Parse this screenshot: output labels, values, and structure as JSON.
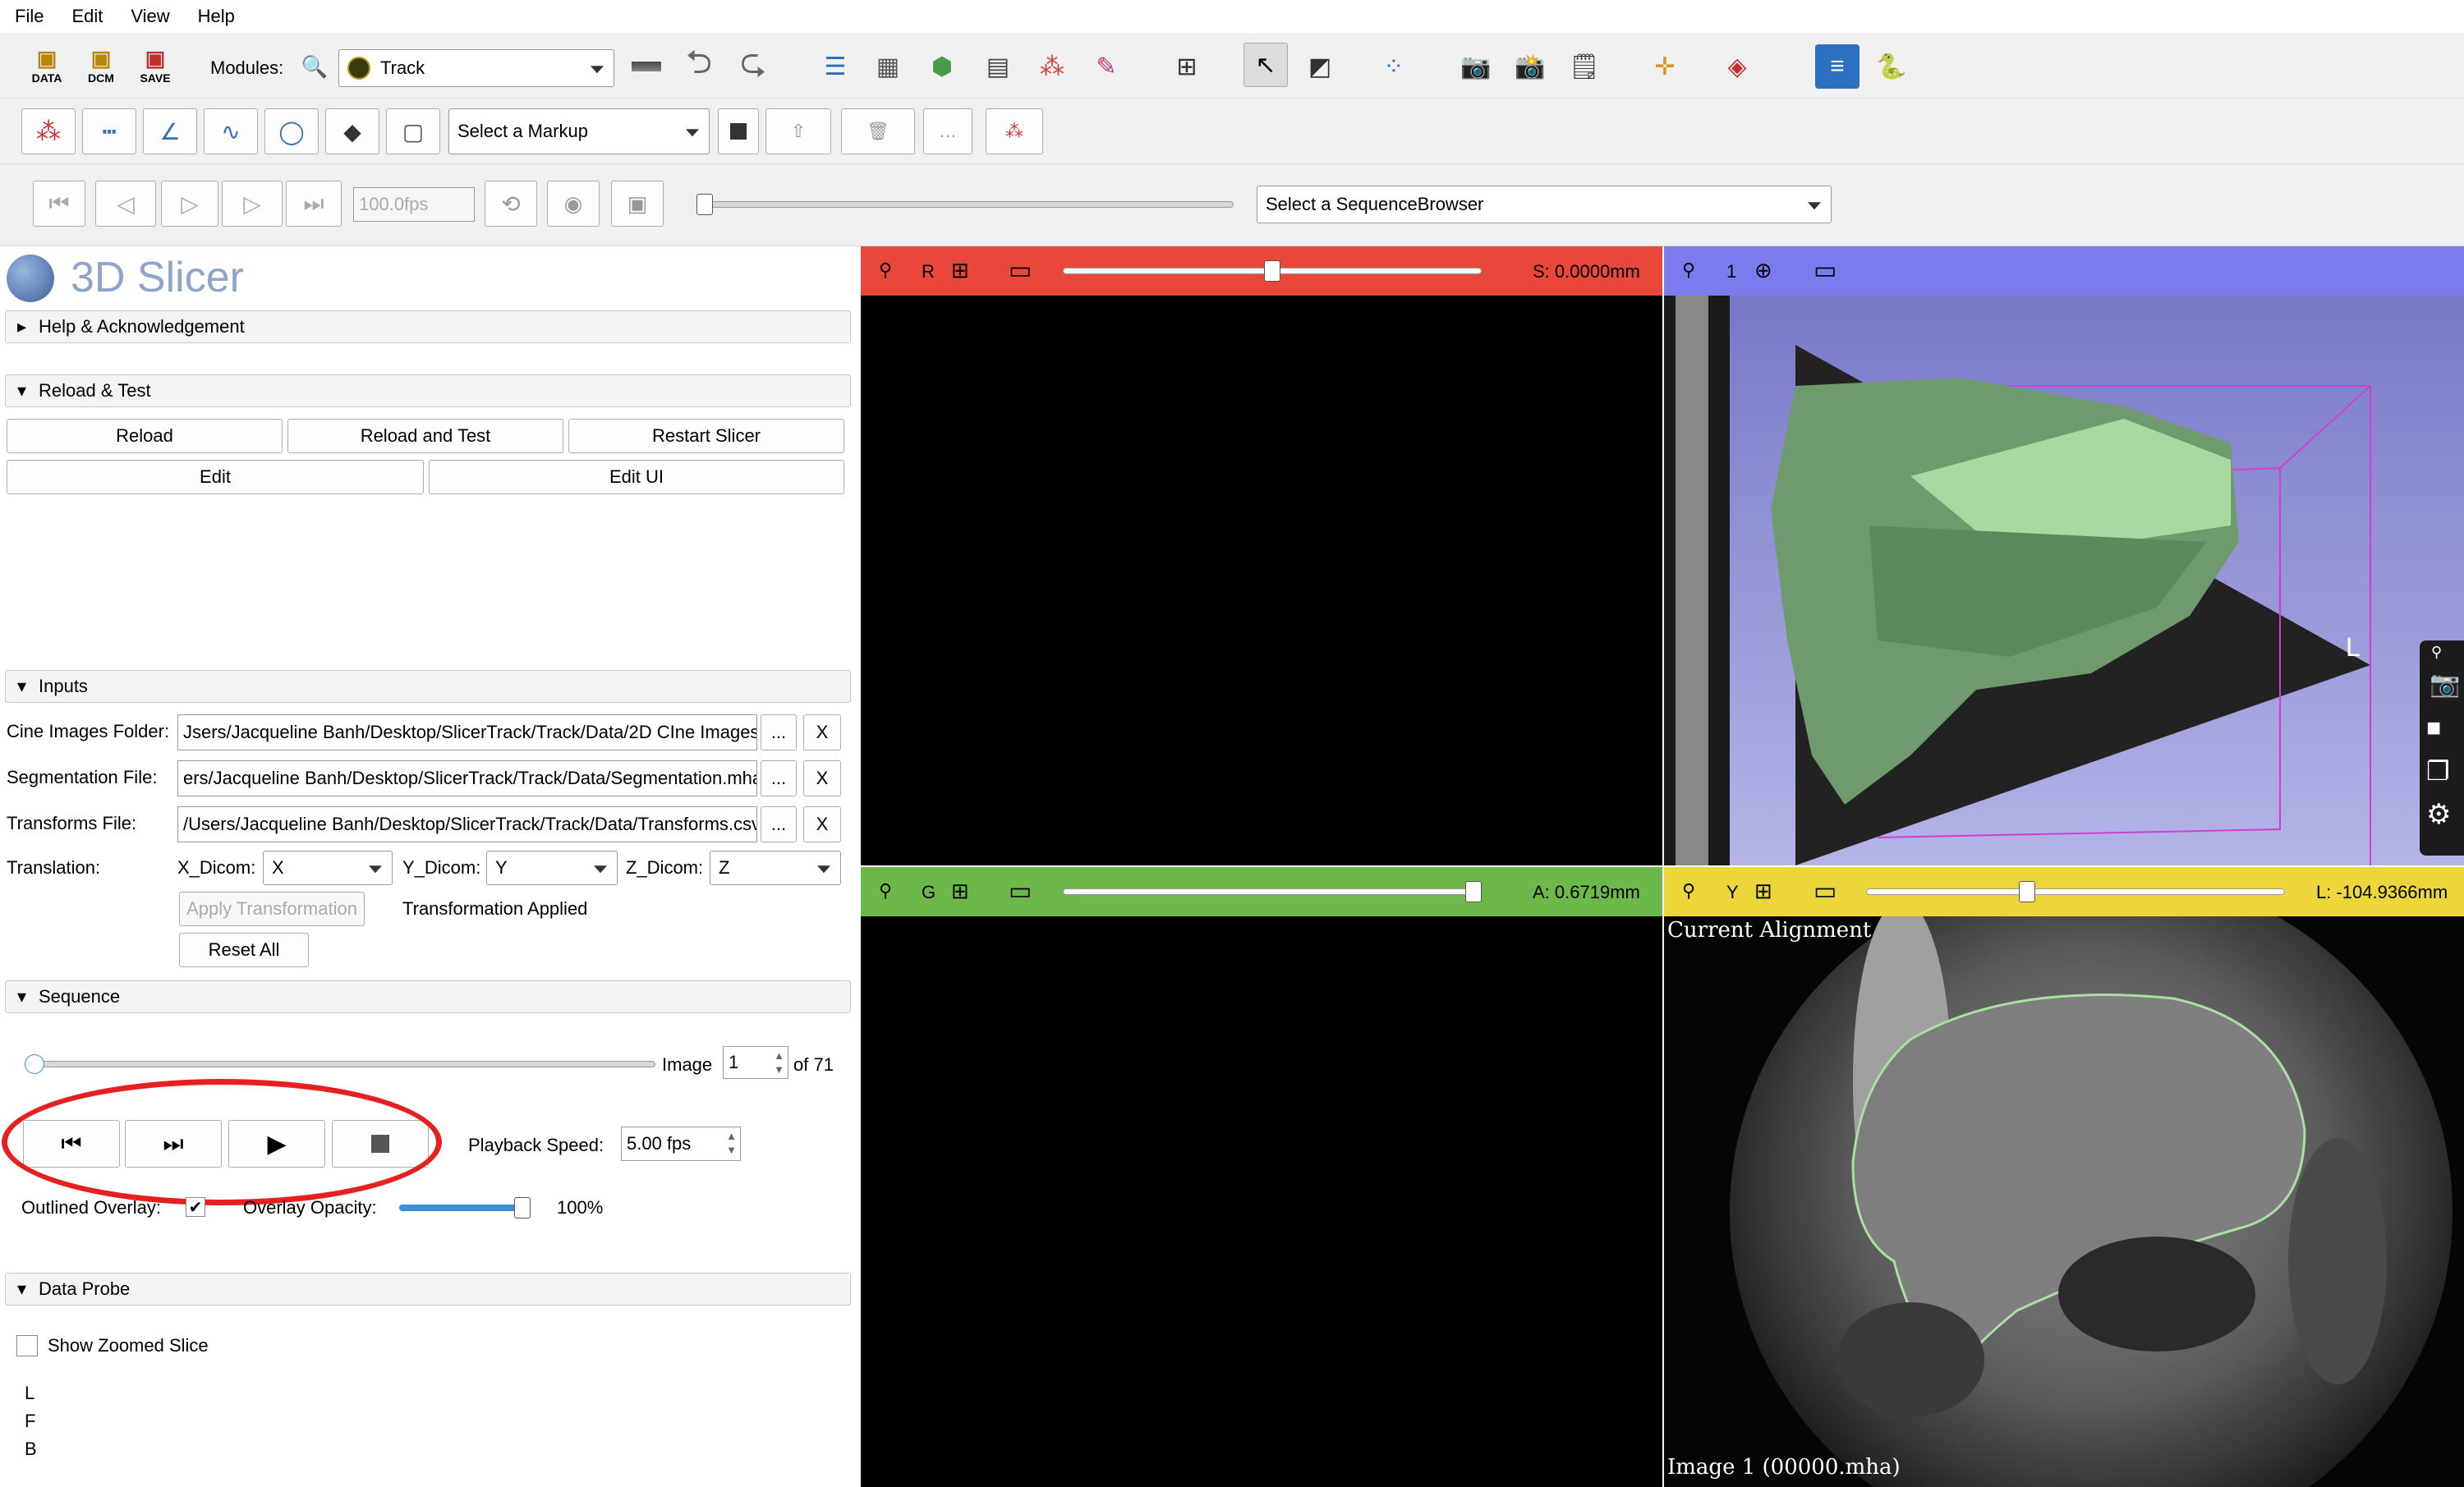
{
  "menu": [
    "File",
    "Edit",
    "View",
    "Help"
  ],
  "toolbar": {
    "data_label": "DATA",
    "dcm_label": "DCM",
    "save_label": "SAVE",
    "modules_label": "Modules:",
    "module_selected": "Track",
    "markup_placeholder": "Select a Markup",
    "fps_value": "100.0fps",
    "sequence_browser_placeholder": "Select a SequenceBrowser"
  },
  "app": {
    "title": "3D Slicer"
  },
  "sections": {
    "help": "Help & Acknowledgement",
    "reload": "Reload & Test",
    "inputs": "Inputs",
    "sequence": "Sequence",
    "data_probe": "Data Probe"
  },
  "reload_buttons": {
    "reload": "Reload",
    "reload_test": "Reload and Test",
    "restart": "Restart Slicer",
    "edit": "Edit",
    "edit_ui": "Edit UI"
  },
  "inputs": {
    "cine_label": "Cine Images Folder:",
    "cine_value": "Jsers/Jacqueline Banh/Desktop/SlicerTrack/Track/Data/2D CIne Images",
    "seg_label": "Segmentation File:",
    "seg_value": "ers/Jacqueline Banh/Desktop/SlicerTrack/Track/Data/Segmentation.mha",
    "trans_label": "Transforms File:",
    "trans_value": "/Users/Jacqueline Banh/Desktop/SlicerTrack/Track/Data/Transforms.csv",
    "browse": "...",
    "clear": "X",
    "translation_label": "Translation:",
    "x_label": "X_Dicom:",
    "x_value": "X",
    "y_label": "Y_Dicom:",
    "y_value": "Y",
    "z_label": "Z_Dicom:",
    "z_value": "Z",
    "apply": "Apply Transformation",
    "status": "Transformation Applied",
    "reset": "Reset All"
  },
  "sequence": {
    "image_label": "Image",
    "image_value": "1",
    "of_label": "of 71",
    "image_progress": 0.0,
    "speed_label": "Playback Speed:",
    "speed_value": "5.00 fps",
    "outlined_label": "Outlined Overlay:",
    "outlined_checked": true,
    "opacity_label": "Overlay Opacity:",
    "opacity_value": "100%",
    "opacity": 1.0
  },
  "data_probe": {
    "zoom_label": "Show Zoomed Slice",
    "letters": [
      "L",
      "F",
      "B"
    ]
  },
  "views": {
    "red": {
      "letter": "R",
      "offset": "S: 0.0000mm",
      "color": "#e8473a",
      "pos": 0.5
    },
    "green": {
      "letter": "G",
      "offset": "A: 0.6719mm",
      "color": "#6cb84a",
      "pos": 1.0
    },
    "threed": {
      "letter": "1",
      "color": "#7b7bf0",
      "orient": "L"
    },
    "yellow": {
      "letter": "Y",
      "offset": "L: -104.9366mm",
      "color": "#ecd63a",
      "pos": 0.38,
      "top_text": "Current Alignment",
      "bottom_text": "Image 1 (00000.mha)"
    }
  },
  "colors": {
    "accent": "#3a8fd8",
    "highlight": "#e62020"
  }
}
